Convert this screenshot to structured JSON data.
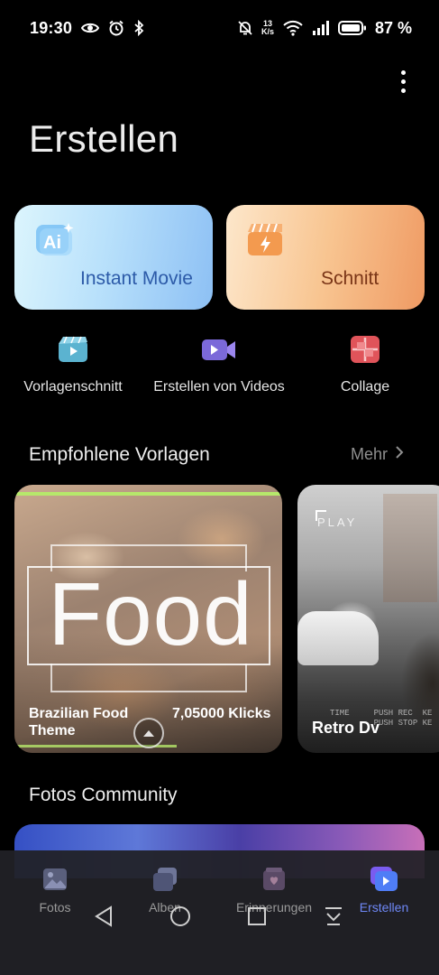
{
  "status_bar": {
    "time": "19:30",
    "net_speed_value": "13",
    "net_speed_unit": "K/s",
    "battery": "87 %"
  },
  "header": {
    "title": "Erstellen",
    "more_icon": "more-vertical-icon"
  },
  "cards": [
    {
      "label": "Instant Movie",
      "icon": "ai-icon"
    },
    {
      "label": "Schnitt",
      "icon": "clapperboard-icon"
    }
  ],
  "quick_actions": [
    {
      "label": "Vorlagenschnitt",
      "icon": "template-video-icon"
    },
    {
      "label": "Erstellen von Videos",
      "icon": "video-camera-icon"
    },
    {
      "label": "Collage",
      "icon": "collage-icon"
    }
  ],
  "recommended": {
    "title": "Empfohlene Vorlagen",
    "more_label": "Mehr",
    "templates": [
      {
        "overlay_word": "Food",
        "name": "Brazilian Food Theme",
        "clicks": "7,05000 Klicks"
      },
      {
        "overlay_word": "PLAY",
        "name": "Retro Dv",
        "hud": "TIME     PUSH REC  KE\n         PUSH STOP KE"
      }
    ]
  },
  "community": {
    "title": "Fotos Community"
  },
  "bottom_nav": {
    "items": [
      {
        "label": "Fotos",
        "icon": "photo-icon",
        "active": false
      },
      {
        "label": "Alben",
        "icon": "albums-icon",
        "active": false
      },
      {
        "label": "Erinnerungen",
        "icon": "memories-icon",
        "active": false
      },
      {
        "label": "Erstellen",
        "icon": "create-video-icon",
        "active": true
      }
    ]
  },
  "colors": {
    "accent": "#6f88f7",
    "background": "#000000",
    "card_instant": "#b9e1fb",
    "card_schnitt": "#f8c591",
    "food_accent_line": "#b6e86b"
  }
}
